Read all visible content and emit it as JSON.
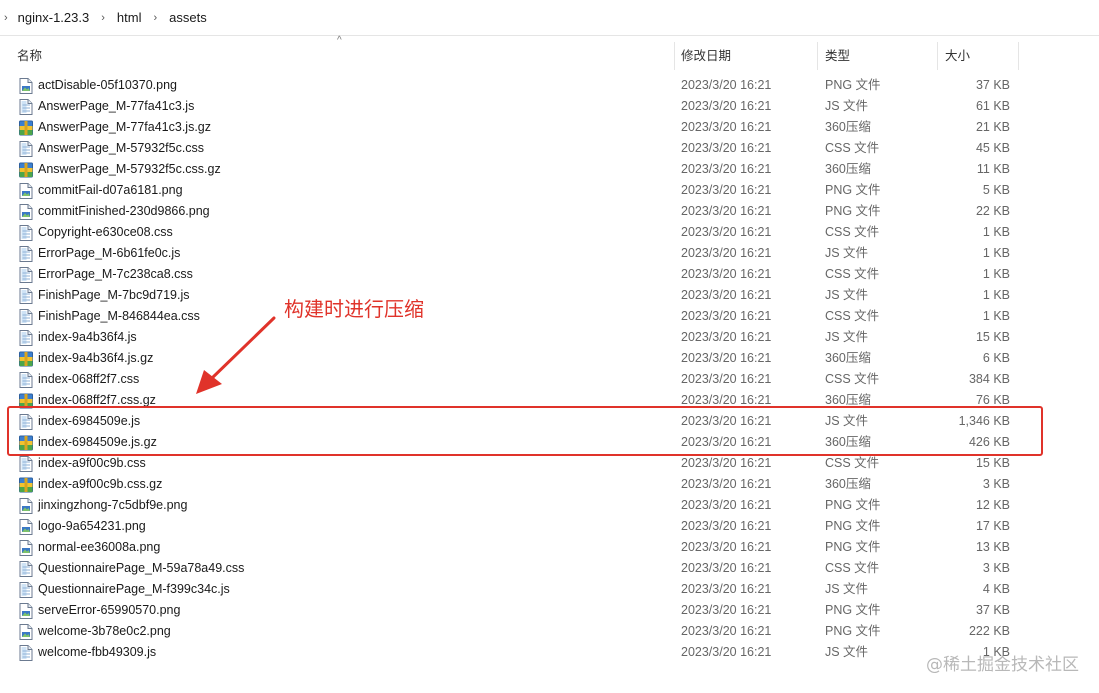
{
  "breadcrumb": {
    "items": [
      "nginx-1.23.3",
      "html",
      "assets"
    ]
  },
  "columns": {
    "name": "名称",
    "date": "修改日期",
    "type": "类型",
    "size": "大小"
  },
  "files": [
    {
      "name": "actDisable-05f10370.png",
      "date": "2023/3/20 16:21",
      "type": "PNG 文件",
      "size": "37 KB",
      "icon": "image-file-icon"
    },
    {
      "name": "AnswerPage_M-77fa41c3.js",
      "date": "2023/3/20 16:21",
      "type": "JS 文件",
      "size": "61 KB",
      "icon": "script-file-icon"
    },
    {
      "name": "AnswerPage_M-77fa41c3.js.gz",
      "date": "2023/3/20 16:21",
      "type": "360压缩",
      "size": "21 KB",
      "icon": "archive-file-icon"
    },
    {
      "name": "AnswerPage_M-57932f5c.css",
      "date": "2023/3/20 16:21",
      "type": "CSS 文件",
      "size": "45 KB",
      "icon": "script-file-icon"
    },
    {
      "name": "AnswerPage_M-57932f5c.css.gz",
      "date": "2023/3/20 16:21",
      "type": "360压缩",
      "size": "11 KB",
      "icon": "archive-file-icon"
    },
    {
      "name": "commitFail-d07a6181.png",
      "date": "2023/3/20 16:21",
      "type": "PNG 文件",
      "size": "5 KB",
      "icon": "image-file-icon"
    },
    {
      "name": "commitFinished-230d9866.png",
      "date": "2023/3/20 16:21",
      "type": "PNG 文件",
      "size": "22 KB",
      "icon": "image-file-icon"
    },
    {
      "name": "Copyright-e630ce08.css",
      "date": "2023/3/20 16:21",
      "type": "CSS 文件",
      "size": "1 KB",
      "icon": "script-file-icon"
    },
    {
      "name": "ErrorPage_M-6b61fe0c.js",
      "date": "2023/3/20 16:21",
      "type": "JS 文件",
      "size": "1 KB",
      "icon": "script-file-icon"
    },
    {
      "name": "ErrorPage_M-7c238ca8.css",
      "date": "2023/3/20 16:21",
      "type": "CSS 文件",
      "size": "1 KB",
      "icon": "script-file-icon"
    },
    {
      "name": "FinishPage_M-7bc9d719.js",
      "date": "2023/3/20 16:21",
      "type": "JS 文件",
      "size": "1 KB",
      "icon": "script-file-icon"
    },
    {
      "name": "FinishPage_M-846844ea.css",
      "date": "2023/3/20 16:21",
      "type": "CSS 文件",
      "size": "1 KB",
      "icon": "script-file-icon"
    },
    {
      "name": "index-9a4b36f4.js",
      "date": "2023/3/20 16:21",
      "type": "JS 文件",
      "size": "15 KB",
      "icon": "script-file-icon"
    },
    {
      "name": "index-9a4b36f4.js.gz",
      "date": "2023/3/20 16:21",
      "type": "360压缩",
      "size": "6 KB",
      "icon": "archive-file-icon"
    },
    {
      "name": "index-068ff2f7.css",
      "date": "2023/3/20 16:21",
      "type": "CSS 文件",
      "size": "384 KB",
      "icon": "script-file-icon"
    },
    {
      "name": "index-068ff2f7.css.gz",
      "date": "2023/3/20 16:21",
      "type": "360压缩",
      "size": "76 KB",
      "icon": "archive-file-icon"
    },
    {
      "name": "index-6984509e.js",
      "date": "2023/3/20 16:21",
      "type": "JS 文件",
      "size": "1,346 KB",
      "icon": "script-file-icon"
    },
    {
      "name": "index-6984509e.js.gz",
      "date": "2023/3/20 16:21",
      "type": "360压缩",
      "size": "426 KB",
      "icon": "archive-file-icon"
    },
    {
      "name": "index-a9f00c9b.css",
      "date": "2023/3/20 16:21",
      "type": "CSS 文件",
      "size": "15 KB",
      "icon": "script-file-icon"
    },
    {
      "name": "index-a9f00c9b.css.gz",
      "date": "2023/3/20 16:21",
      "type": "360压缩",
      "size": "3 KB",
      "icon": "archive-file-icon"
    },
    {
      "name": "jinxingzhong-7c5dbf9e.png",
      "date": "2023/3/20 16:21",
      "type": "PNG 文件",
      "size": "12 KB",
      "icon": "image-file-icon"
    },
    {
      "name": "logo-9a654231.png",
      "date": "2023/3/20 16:21",
      "type": "PNG 文件",
      "size": "17 KB",
      "icon": "image-file-icon"
    },
    {
      "name": "normal-ee36008a.png",
      "date": "2023/3/20 16:21",
      "type": "PNG 文件",
      "size": "13 KB",
      "icon": "image-file-icon"
    },
    {
      "name": "QuestionnairePage_M-59a78a49.css",
      "date": "2023/3/20 16:21",
      "type": "CSS 文件",
      "size": "3 KB",
      "icon": "script-file-icon"
    },
    {
      "name": "QuestionnairePage_M-f399c34c.js",
      "date": "2023/3/20 16:21",
      "type": "JS 文件",
      "size": "4 KB",
      "icon": "script-file-icon"
    },
    {
      "name": "serveError-65990570.png",
      "date": "2023/3/20 16:21",
      "type": "PNG 文件",
      "size": "37 KB",
      "icon": "image-file-icon"
    },
    {
      "name": "welcome-3b78e0c2.png",
      "date": "2023/3/20 16:21",
      "type": "PNG 文件",
      "size": "222 KB",
      "icon": "image-file-icon"
    },
    {
      "name": "welcome-fbb49309.js",
      "date": "2023/3/20 16:21",
      "type": "JS 文件",
      "size": "1 KB",
      "icon": "script-file-icon"
    }
  ],
  "annotation": {
    "text": "构建时进行压缩",
    "color": "#e0332a"
  },
  "watermark": "@稀土掘金技术社区"
}
